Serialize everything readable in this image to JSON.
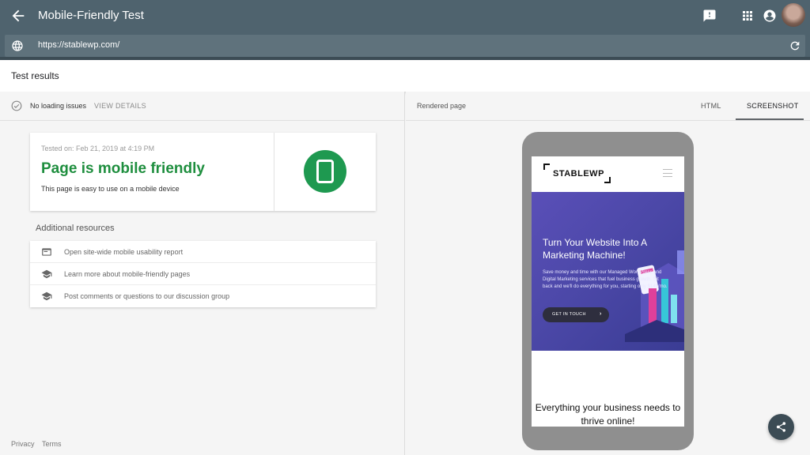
{
  "app": {
    "title": "Mobile-Friendly Test"
  },
  "urlbar": {
    "url": "https://stablewp.com/"
  },
  "results_bar": {
    "label": "Test results"
  },
  "left_panel": {
    "status_text": "No loading issues",
    "view_details": "VIEW DETAILS",
    "card": {
      "tested_on": "Tested on: Feb 21, 2019 at 4:19 PM",
      "headline": "Page is mobile friendly",
      "subtext": "This page is easy to use on a mobile device"
    },
    "additional_resources": "Additional resources",
    "resources": [
      {
        "label": "Open site-wide mobile usability report",
        "icon": "browser-window-icon"
      },
      {
        "label": "Learn more about mobile-friendly pages",
        "icon": "graduation-cap-icon"
      },
      {
        "label": "Post comments or questions to our discussion group",
        "icon": "graduation-cap-icon"
      }
    ],
    "footer": {
      "privacy": "Privacy",
      "terms": "Terms"
    }
  },
  "right_panel": {
    "rendered_label": "Rendered page",
    "tabs": [
      {
        "label": "HTML",
        "active": false
      },
      {
        "label": "SCREENSHOT",
        "active": true
      }
    ],
    "preview": {
      "logo": "STABLEWP",
      "hero_title": "Turn Your Website Into A Marketing Machine!",
      "hero_text": "Save money and time with our Managed WordPress and Digital Marketing services that fuel business growth. Sit back and we'll do everything for you, starting only $149/mo.",
      "cta": "GET IN TOUCH",
      "bottom_text": "Everything your business needs to thrive online!"
    }
  },
  "colors": {
    "topbar": "#4f636e",
    "success_green": "#1e8e3e",
    "badge_green": "#1e9950",
    "hero_purple": "#4c48a8"
  }
}
